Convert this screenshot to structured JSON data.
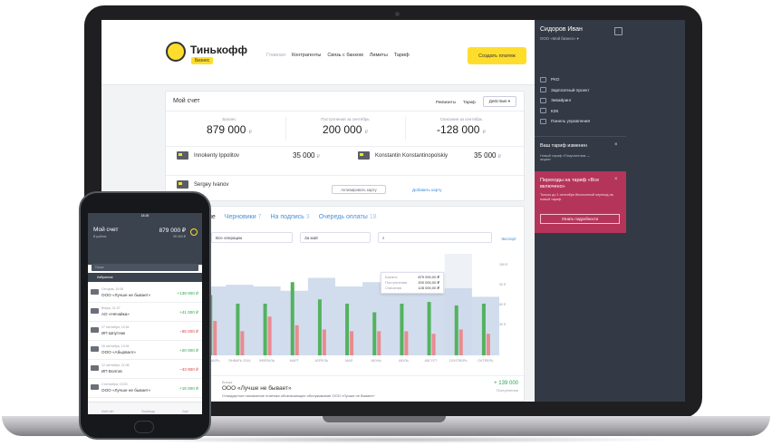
{
  "brand": {
    "name": "Тинькофф",
    "badge": "Бизнес"
  },
  "nav": [
    "Главная",
    "Контрагенты",
    "Связь с банком",
    "Лимиты",
    "Тариф"
  ],
  "create_button": "Создать платеж",
  "account": {
    "title": "Мой счет",
    "links": [
      "Реквизиты",
      "Тариф"
    ],
    "actions": "Действия",
    "kpis": [
      {
        "label": "Баланс",
        "value": "879 000",
        "currency": "₽"
      },
      {
        "label": "Поступления за сентябрь",
        "value": "200 000",
        "currency": "₽"
      },
      {
        "label": "Списания за сентябрь",
        "value": "-128 000",
        "currency": "₽"
      }
    ],
    "cards": [
      {
        "holder": "Innokenty Ippolitov",
        "amount": "35 000",
        "currency": "₽"
      },
      {
        "holder": "Konstantin Konstantinopolskiy",
        "amount": "35 000",
        "currency": "₽"
      },
      {
        "holder": "Sergey Ivanov"
      }
    ],
    "activate_card": "Активировать карту",
    "add_card": "Добавить карту"
  },
  "operations": {
    "tabs": [
      {
        "label": "ные",
        "count": ""
      },
      {
        "label": "Черновики",
        "count": "7"
      },
      {
        "label": "На подпись",
        "count": "3"
      },
      {
        "label": "Очередь оплаты",
        "count": "18"
      }
    ],
    "filters": {
      "type": "Все операции",
      "period": "За май",
      "search_placeholder": ""
    },
    "export": "Экспорт",
    "tooltip": [
      {
        "k": "Баланс",
        "v": "879 000,00 ₽"
      },
      {
        "k": "Поступления",
        "v": "200 000,00 ₽"
      },
      {
        "k": "Списания",
        "v": "128 000,00 ₽"
      }
    ],
    "op": {
      "date": "Вчера",
      "name": "ООО «Лучше не бывает»",
      "desc": "Стандартное назначение платежа обозначающее обслуживание ООО «Лучше не бывает»",
      "amount": "+ 139 000",
      "type": "Поступление"
    }
  },
  "chart_data": {
    "type": "bar",
    "categories": [
      "ОКТ",
      "ДЕКАБРЬ",
      "ЯНВАРЬ 2016",
      "ФЕВРАЛЬ",
      "МАРТ",
      "АПРЕЛЬ",
      "МАЙ",
      "ИЮНЬ",
      "ИЮЛЬ",
      "АВГУСТ",
      "СЕНТЯБРЬ",
      "ОКТЯБРЬ"
    ],
    "x_labels": [
      "ТЯБРЬ",
      "ДЕКАБРЬ",
      "ЯНВАРЬ\n2016",
      "ФЕВРАЛЬ",
      "МАРТ",
      "АПРЕЛЬ",
      "МАЙ",
      "ИЮНЬ",
      "ИЮЛЬ",
      "АВГУСТ",
      "СЕНТЯБРЬ",
      "ОКТЯБРЬ"
    ],
    "series": [
      {
        "name": "Баланс",
        "values": [
          62,
          80,
          82,
          80,
          75,
          90,
          80,
          85,
          75,
          72,
          78,
          68
        ]
      },
      {
        "name": "Поступления",
        "values": [
          55,
          70,
          60,
          60,
          85,
          65,
          60,
          50,
          60,
          62,
          58,
          60
        ]
      },
      {
        "name": "Списания",
        "values": [
          22,
          40,
          28,
          45,
          35,
          30,
          28,
          28,
          28,
          25,
          30,
          25
        ]
      }
    ],
    "y_ticks": [
      "150 ₽",
      "90 ₽",
      "60 ₽",
      "30 ₽"
    ],
    "ylim": [
      0,
      100
    ],
    "colors": {
      "balance": "#c9d7ea",
      "income": "#53b25f",
      "expense": "#e98b90"
    },
    "highlight_index": 10
  },
  "sidebar": {
    "user": "Сидоров Иван",
    "org": "ООО «Мой бизнес» ▾",
    "menu": [
      "РКО",
      "Зарплатный проект",
      "Эквайринг",
      "КЗК",
      "Панель управления"
    ],
    "notice_title": "Ваш тариф изменен",
    "notice_text": "Новый тариф «Покупателям — акция»",
    "promo_title": "Переходы на тариф «Все включено»",
    "promo_text": "Только до 1 сентября бесплатный переход на новый тариф",
    "promo_button": "Узнать подробности"
  },
  "phone": {
    "time": "18:26",
    "account": "Мой счет",
    "account_sub": "В рублях",
    "balance": "879 000 ₽",
    "balance_sub": "99 000 ₽",
    "search": "Поиск",
    "tab": "Избранное",
    "items": [
      {
        "date": "Сегодня, 10:08",
        "name": "ООО «Лучше не бывает»",
        "amount": "+139 000 ₽",
        "dir": "in"
      },
      {
        "date": "Вчера, 21:07",
        "name": "АО «Нечайка»",
        "amount": "+41 000 ₽",
        "dir": "in"
      },
      {
        "date": "27 сентября, 10:34",
        "name": "ИП Шпутлик",
        "amount": "−65 000 ₽",
        "dir": "out"
      },
      {
        "date": "26 сентября, 10:34",
        "name": "ООО «Абырвалг»",
        "amount": "+20 000 ₽",
        "dir": "in"
      },
      {
        "date": "12 сентября, 21:08",
        "name": "ИП Волгов",
        "amount": "−43 900 ₽",
        "dir": "out"
      },
      {
        "date": "3 сентября, 10:00",
        "name": "ООО «Лучше не бывает»",
        "amount": "+15 000 ₽",
        "dir": "in"
      }
    ],
    "nav": [
      "Мой счёт",
      "Переводы",
      "Ещё"
    ]
  }
}
